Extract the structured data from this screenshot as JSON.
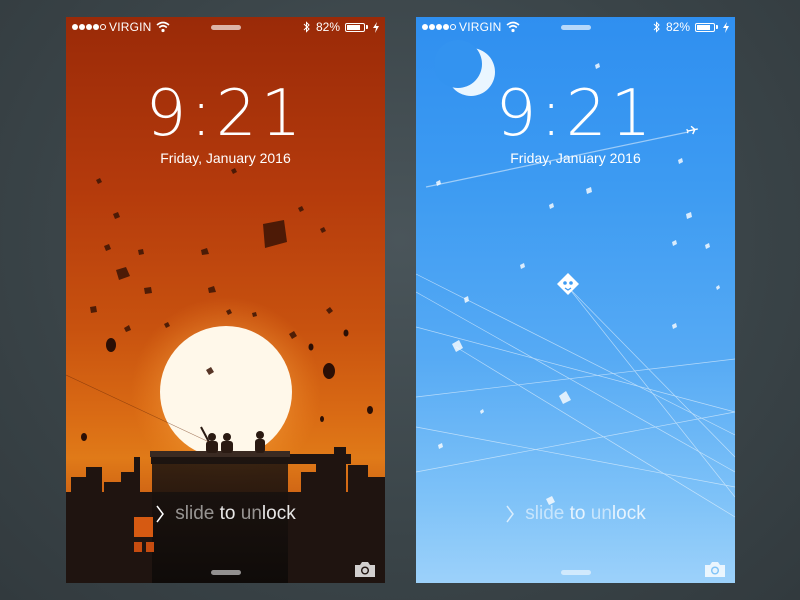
{
  "screens": [
    {
      "theme": "sunset",
      "status_bar": {
        "carrier": "VIRGIN",
        "battery": "82%",
        "signal_bars": 4
      },
      "time": "9:21",
      "date": "Friday, January 2016",
      "slide_parts": [
        "slide ",
        "to",
        " un",
        "lock"
      ]
    },
    {
      "theme": "sky",
      "status_bar": {
        "carrier": "VIRGIN",
        "battery": "82%",
        "signal_bars": 4
      },
      "time": "9:21",
      "date": "Friday, January 2016",
      "slide_parts": [
        "slide ",
        "to",
        " un",
        "lock"
      ]
    }
  ],
  "icons": [
    "wifi-icon",
    "bluetooth-icon",
    "battery-icon",
    "charging-icon",
    "chevron-right-icon",
    "camera-icon",
    "moon-icon",
    "airplane-icon",
    "kite-icon"
  ],
  "colors": {
    "sunset_top": "#9a2a08",
    "sunset_mid": "#d96a14",
    "sky_top": "#2f8ff0",
    "sky_bottom": "#9cd1fa",
    "background": "#3a4448"
  }
}
